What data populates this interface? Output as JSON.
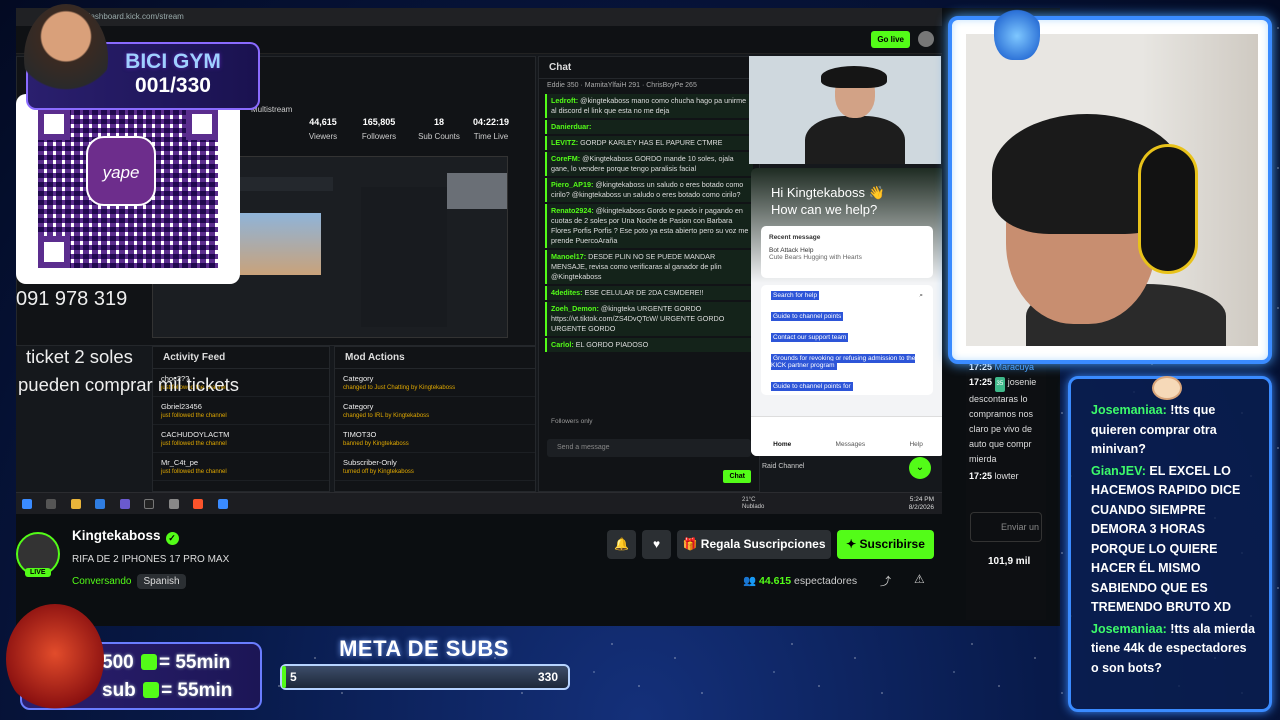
{
  "browser": {
    "url": "dashboard.kick.com/stream"
  },
  "dashboard": {
    "go_live": "Go live",
    "multistream": "Multistream",
    "stats": [
      {
        "value": "44,615",
        "label": "Viewers"
      },
      {
        "value": "165,805",
        "label": "Followers"
      },
      {
        "value": "18",
        "label": "Sub Counts"
      },
      {
        "value": "04:22:19",
        "label": "Time Live"
      }
    ],
    "chat_title": "Chat",
    "chat_top": [
      "Eddie 350",
      "MamitaYlfaiH 291",
      "ChrisBoyPe 265"
    ],
    "chat_lines": [
      {
        "user": "Ledroft:",
        "text": "@kingtekaboss mano como chucha hago pa unirme al discord el link que esta no me deja"
      },
      {
        "user": "Danierduar:",
        "text": ""
      },
      {
        "user": "LEVITZ:",
        "text": "GORDP KARLEY HAS EL PAPURE CTMRE"
      },
      {
        "user": "CoreFM:",
        "text": "@Kingtekaboss GORDO mande 10 soles, ojala gane, lo vendere porque tengo paralisis facial"
      },
      {
        "user": "Piero_AP19:",
        "text": "@kingtekaboss un saludo o eres botado como cirilo? @kingtekaboss un saludo o eres botado como cirilo?"
      },
      {
        "user": "Renato2924:",
        "text": "@kingtekaboss Gordo te puedo ir pagando en cuotas de 2 soles por Una Noche de Pasion con Barbara Flores Porfis Porfis ? Ese poto ya esta abierto pero su voz me prende PuercoAraña"
      },
      {
        "user": "Manoel17:",
        "text": "DESDE PLIN NO SE PUEDE MANDAR MENSAJE, revisa como verificaras al ganador de plin @Kingtekaboss"
      },
      {
        "user": "4dedites:",
        "text": "ESE CELULAR DE 2DA CSMDERE!!"
      },
      {
        "user": "Zoeh_Demon:",
        "text": "@kingteka URGENTE GORDO https://vt.tiktok.com/ZS4DvQTcW/ URGENTE GORDO URGENTE GORDO"
      },
      {
        "user": "Carlol:",
        "text": "EL GORDO PIADOSO"
      },
      {
        "user": "CoreFM:",
        "text": "@Kingtekaboss GORDO mande 10 soles, ojala gane, lo vendere porque tengo paralisis facial (Deleted)"
      }
    ],
    "followers_only": "Followers only",
    "send_placeholder": "Send a message",
    "send_label": "Chat",
    "raid_label": "Raid Channel",
    "activity_title": "Activity Feed",
    "activity": [
      {
        "name": "choc2??",
        "sub": "just followed the channel",
        "time": "20 minutes ago"
      },
      {
        "name": "Gbriel23456",
        "sub": "just followed the channel",
        "time": "20 seconds ago"
      },
      {
        "name": "CACHUDOYLACTM",
        "sub": "just followed the channel",
        "time": "1 minute ago"
      },
      {
        "name": "Mr_C4t_pe",
        "sub": "just followed the channel",
        "time": "3 minutes ago"
      },
      {
        "name": "EsteNoEsYamcom",
        "sub": "just followed the channel",
        "time": "4 minutes ago"
      }
    ],
    "mod_title": "Mod Actions",
    "mod": [
      {
        "name": "Category",
        "sub": "changed to Just Chatting by Kingtekaboss",
        "time": "26 minutes ago"
      },
      {
        "name": "Category",
        "sub": "changed to IRL by Kingtekaboss",
        "time": "2 hours ago"
      },
      {
        "name": "TIMOT3O",
        "sub": "banned by Kingtekaboss",
        "time": "2 hours ago"
      },
      {
        "name": "Subscriber-Only",
        "sub": "turned off by Kingtekaboss",
        "time": "2 hours ago"
      },
      {
        "name": "Subscriber-Only",
        "sub": "",
        "time": ""
      }
    ],
    "clock": {
      "time": "5:24 PM",
      "date": "8/2/2026"
    },
    "weather": {
      "temp": "21°C",
      "desc": "Nublado"
    }
  },
  "help": {
    "greeting": "Hi Kingtekaboss 👋",
    "question": "How can we help?",
    "recent_title": "Recent message",
    "recent_from": "Bot Attack Help",
    "recent_text": "Cute Bears Hugging with Hearts",
    "recent_time": "3h",
    "search": "Search for help",
    "items": [
      "Guide to channel points",
      "Contact our support team",
      "Grounds for revoking or refusing admission to the KICK partner program",
      "Guide to channel points for"
    ],
    "send_msg": "Send us a message",
    "nav": [
      "Home",
      "Messages",
      "Help"
    ]
  },
  "stream_info": {
    "streamer": "Kingtekaboss",
    "live": "LIVE",
    "title": "RIFA DE 2 IPHONES 17 PRO MAX",
    "category": "Conversando",
    "language": "Spanish",
    "gift_label": "Regala Suscripciones",
    "subscribe_label": "Suscribirse",
    "viewers": "44.615",
    "viewers_label": "espectadores"
  },
  "side_chat": {
    "lines": [
      {
        "time": "17:25",
        "user": "Maracuya",
        "text": ""
      },
      {
        "time": "17:25",
        "user": "josenie",
        "text": "descontaras lo compramos nos claro pe vivo de auto que compr mierda"
      },
      {
        "time": "17:25",
        "user": "lowter",
        "text": ""
      }
    ],
    "send_placeholder": "Enviar un",
    "viewers": "101,9 mil"
  },
  "overlay": {
    "bici_title": "BICI GYM",
    "bici_count": "001/330",
    "yape": "yape",
    "phone": "091 978 319",
    "ticket_line1": "ticket 2 soles",
    "ticket_line2": "pueden comprar mil tickets",
    "subs_line1": "500",
    "subs_line1b": "= 55min",
    "subs_line2": "sub",
    "subs_line2b": "= 55min",
    "meta_title": "META DE SUBS",
    "meta_current": "5",
    "meta_goal": "330",
    "meta_progress": 0.015
  },
  "overlay_chat": [
    {
      "user": "Josemaniaa:",
      "text": "!tts que quieren comprar otra minivan?"
    },
    {
      "user": "GianJEV:",
      "text": "EL EXCEL LO HACEMOS RAPIDO DICE CUANDO SIEMPRE DEMORA 3 HORAS PORQUE LO QUIERE HACER ÉL MISMO SABIENDO QUE ES TREMENDO BRUTO XD"
    },
    {
      "user": "Josemaniaa:",
      "text": "!tts ala mierda tiene 44k de espectadores o son bots?"
    }
  ],
  "colors": {
    "kick_green": "#53fc18",
    "frame_blue": "#3a8bff",
    "yape_purple": "#6d2d8c"
  }
}
